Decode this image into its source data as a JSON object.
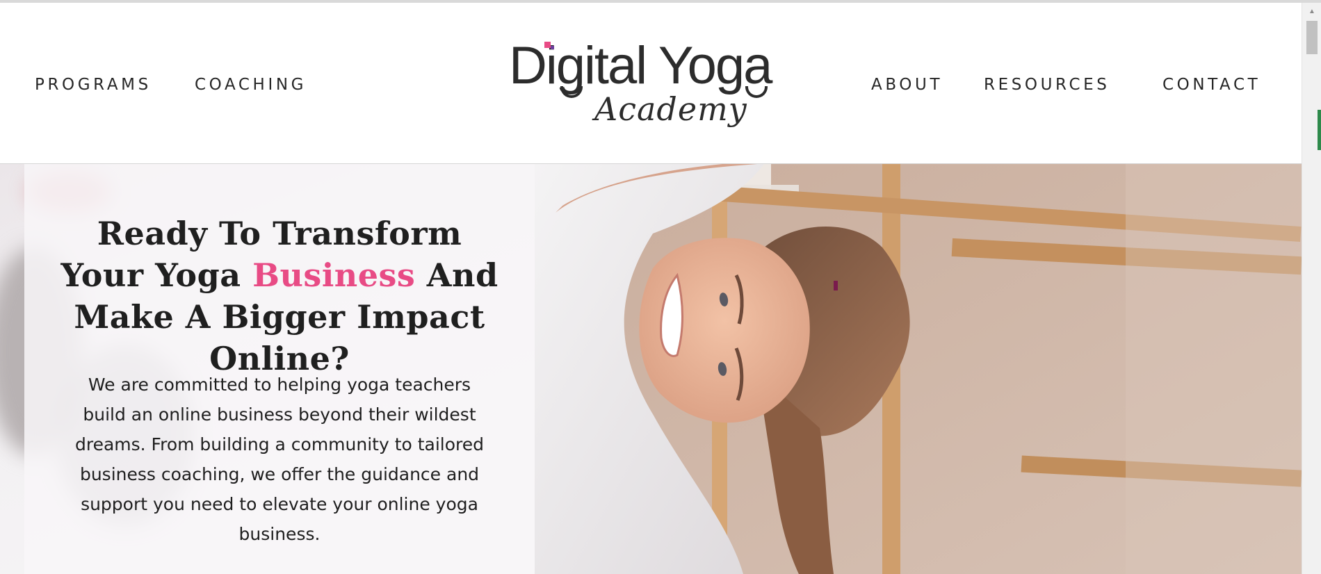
{
  "nav": {
    "left": [
      "PROGRAMS",
      "COACHING"
    ],
    "right": [
      "ABOUT",
      "RESOURCES",
      "CONTACT"
    ]
  },
  "logo": {
    "main": "Digital Yoga",
    "sub": "Academy",
    "accent_colors": [
      "#e84b85",
      "#6b3e9c"
    ]
  },
  "hero": {
    "headline_1": "Ready To Transform Your Yoga ",
    "headline_highlight": "Business",
    "headline_2": " And Make A Bigger Impact Online?",
    "body": "We are committed to helping yoga teachers build an online business beyond their wildest dreams. From building a community to tailored business coaching, we offer the guidance and support you need to elevate your online yoga business.",
    "highlight_color": "#e84b85"
  },
  "scrollbar": {
    "up_arrow": "▲"
  }
}
